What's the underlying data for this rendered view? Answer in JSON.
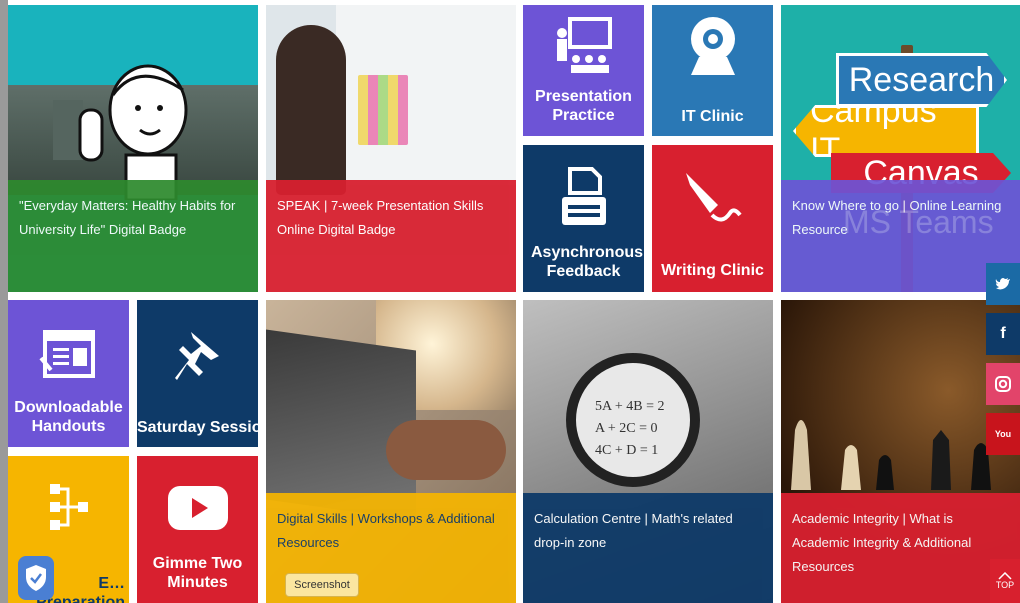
{
  "tiles": {
    "healthy_habits": "\"Everyday Matters: Healthy Habits for University Life\" Digital Badge",
    "speak": "SPEAK | 7-week Presentation Skills Online Digital Badge",
    "presentation_practice": "Presentation Practice",
    "it_clinic": "IT Clinic",
    "asynchronous_feedback": "Asynchronous Feedback",
    "writing_clinic": "Writing Clinic",
    "know_where": "Know Where to go | Online Learning Resource",
    "downloadable_handouts": "Downloadable Handouts",
    "saturday_sessions": "Saturday Sessions",
    "exam_preparation": "E… Preparation",
    "gimme_two_minutes": "Gimme Two Minutes",
    "digital_skills": "Digital Skills | Workshops & Additional Resources",
    "calculation_centre": "Calculation Centre | Math's related drop-in zone",
    "academic_integrity": "Academic Integrity | What is Academic Integrity & Additional Resources"
  },
  "signpost": {
    "research": "Research",
    "campus_it": "Campus IT",
    "canvas": "Canvas",
    "ms_teams": "MS Teams"
  },
  "social": {
    "twitter": "twitter",
    "facebook": "f",
    "instagram": "instagram",
    "youtube": "You"
  },
  "top_button": "TOP",
  "tooltip": "Screenshot",
  "colors": {
    "teal": "#19b3bd",
    "purple": "#6d54d6",
    "blue": "#2a78b5",
    "navy": "#0e3a68",
    "red": "#d8202f",
    "yellow": "#f6b500",
    "green": "#2e8a2e"
  }
}
